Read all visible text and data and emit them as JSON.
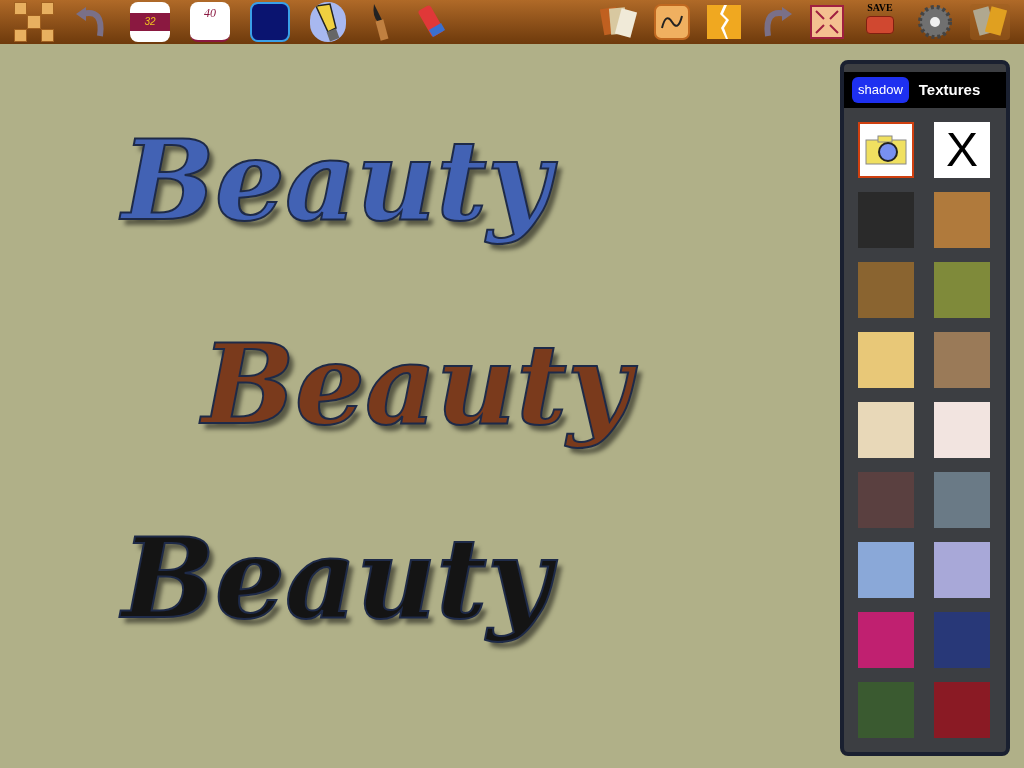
{
  "toolbar_left": [
    {
      "kind": "letters"
    },
    {
      "kind": "undo"
    },
    {
      "kind": "size",
      "label": "32"
    },
    {
      "kind": "angle",
      "label": "40"
    },
    {
      "kind": "color",
      "color": "#0a1470"
    },
    {
      "kind": "pen",
      "selected": true
    },
    {
      "kind": "brush",
      "selected": false
    },
    {
      "kind": "eraser",
      "selected": false
    }
  ],
  "toolbar_right": [
    {
      "kind": "papers"
    },
    {
      "kind": "ornament"
    },
    {
      "kind": "torn"
    },
    {
      "kind": "redo"
    },
    {
      "kind": "fullscreen"
    },
    {
      "kind": "save",
      "label": "SAVE"
    },
    {
      "kind": "settings"
    },
    {
      "kind": "textures",
      "selected": true
    }
  ],
  "canvas_words": [
    {
      "text": "Beauty",
      "color": "#4262b4"
    },
    {
      "text": "Beauty",
      "color": "#7a3a1c"
    },
    {
      "text": "Beauty",
      "color": "#141414"
    }
  ],
  "panel": {
    "shadow_button": "shadow",
    "title": "Textures",
    "tiles": [
      {
        "kind": "camera",
        "selected": true
      },
      {
        "kind": "none",
        "label": "X",
        "selected": false
      },
      {
        "kind": "swatch",
        "color": "#2a2a2a",
        "selected": false
      },
      {
        "kind": "swatch",
        "color": "#b07a3c",
        "selected": false
      },
      {
        "kind": "swatch",
        "color": "#8a6430",
        "selected": false
      },
      {
        "kind": "swatch",
        "color": "#7f8a3a",
        "selected": false
      },
      {
        "kind": "swatch",
        "color": "#e8c878",
        "selected": false
      },
      {
        "kind": "swatch",
        "color": "#9a7a58",
        "selected": false
      },
      {
        "kind": "swatch",
        "color": "#e8d8b8",
        "selected": false
      },
      {
        "kind": "swatch",
        "color": "#f2e4e0",
        "selected": false
      },
      {
        "kind": "swatch",
        "color": "#5a4040",
        "selected": false
      },
      {
        "kind": "swatch",
        "color": "#6a7a86",
        "selected": false
      },
      {
        "kind": "swatch",
        "color": "#8aa8d8",
        "selected": false
      },
      {
        "kind": "swatch",
        "color": "#a8a8d8",
        "selected": false
      },
      {
        "kind": "swatch",
        "color": "#c02070",
        "selected": false
      },
      {
        "kind": "swatch",
        "color": "#283878",
        "selected": false
      },
      {
        "kind": "swatch",
        "color": "#3a5a30",
        "selected": false
      },
      {
        "kind": "swatch",
        "color": "#8a1a24",
        "selected": false
      }
    ]
  }
}
